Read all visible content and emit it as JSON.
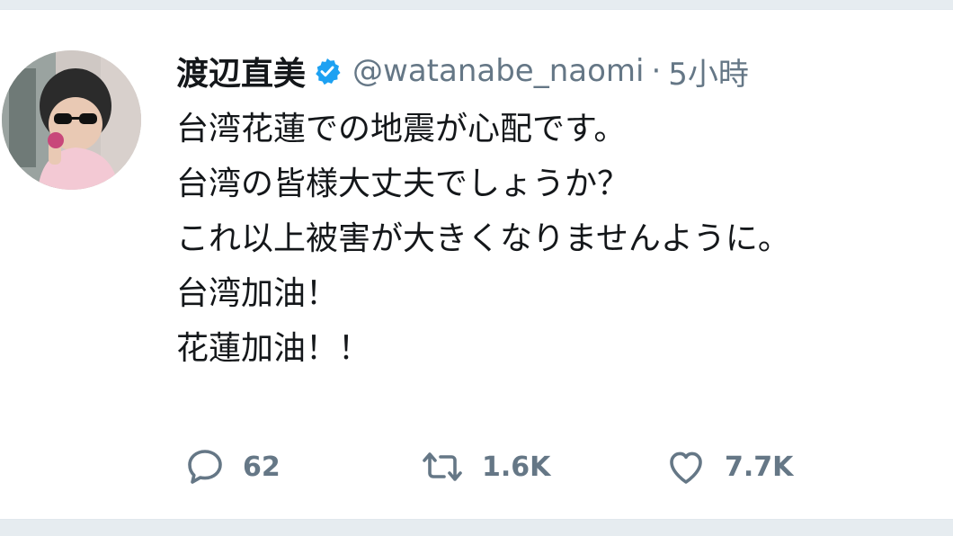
{
  "tweet": {
    "author": {
      "display_name": "渡辺直美",
      "handle": "@watanabe_naomi",
      "verified_icon": "verified-badge-icon"
    },
    "separator": "·",
    "time": "5小時",
    "lines": [
      "台湾花蓮での地震が心配です。",
      "台湾の皆様大丈夫でしょうか？",
      "これ以上被害が大きくなりませんように。",
      "台湾加油！",
      "花蓮加油！！"
    ],
    "actions": {
      "reply": {
        "icon": "reply-icon",
        "count": "62"
      },
      "retweet": {
        "icon": "retweet-icon",
        "count": "1.6K"
      },
      "like": {
        "icon": "heart-icon",
        "count": "7.7K"
      }
    }
  },
  "colors": {
    "text": "#14171a",
    "secondary": "#657786",
    "verified": "#1da1f2",
    "background": "#e6ecf0"
  }
}
